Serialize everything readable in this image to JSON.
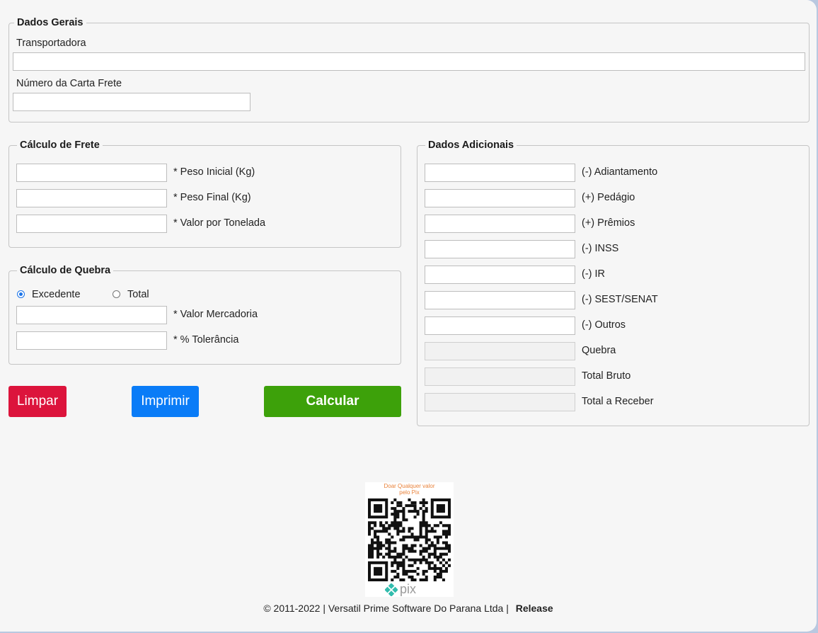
{
  "dados_gerais": {
    "legend": "Dados Gerais",
    "transportadora_label": "Transportadora",
    "transportadora_value": "",
    "numero_carta_label": "Número da Carta Frete",
    "numero_carta_value": ""
  },
  "calculo_frete": {
    "legend": "Cálculo de Frete",
    "fields": [
      {
        "label": "* Peso Inicial (Kg)",
        "value": ""
      },
      {
        "label": "* Peso Final (Kg)",
        "value": ""
      },
      {
        "label": "* Valor por Tonelada",
        "value": ""
      }
    ]
  },
  "calculo_quebra": {
    "legend": "Cálculo de Quebra",
    "radio_excedente": "Excedente",
    "radio_total": "Total",
    "selected": "Excedente",
    "fields": [
      {
        "label": "* Valor Mercadoria",
        "value": ""
      },
      {
        "label": "* % Tolerância",
        "value": ""
      }
    ]
  },
  "dados_adicionais": {
    "legend": "Dados Adicionais",
    "fields": [
      {
        "label": "(-) Adiantamento",
        "value": ""
      },
      {
        "label": "(+) Pedágio",
        "value": ""
      },
      {
        "label": "(+) Prêmios",
        "value": ""
      },
      {
        "label": "(-) INSS",
        "value": ""
      },
      {
        "label": "(-) IR",
        "value": ""
      },
      {
        "label": "(-) SEST/SENAT",
        "value": ""
      },
      {
        "label": "(-) Outros",
        "value": ""
      },
      {
        "label": "Quebra",
        "value": ""
      },
      {
        "label": "Total Bruto",
        "value": ""
      },
      {
        "label": "Total a Receber",
        "value": ""
      }
    ]
  },
  "buttons": {
    "limpar": "Limpar",
    "imprimir": "Imprimir",
    "calcular": "Calcular"
  },
  "colors": {
    "limpar": "#dc143c",
    "imprimir": "#0a7cf7",
    "calcular": "#3da10a",
    "pix_accent": "#32bcad",
    "pix_caption": "#e9823a"
  },
  "donation": {
    "caption_line1": "Doar Qualquer valor",
    "caption_line2": "pelo Pix",
    "pix_logo_text": "pix"
  },
  "footer": {
    "copyright": "© 2011-2022 | Versatil Prime Software Do Parana Ltda |",
    "release": "Release"
  }
}
